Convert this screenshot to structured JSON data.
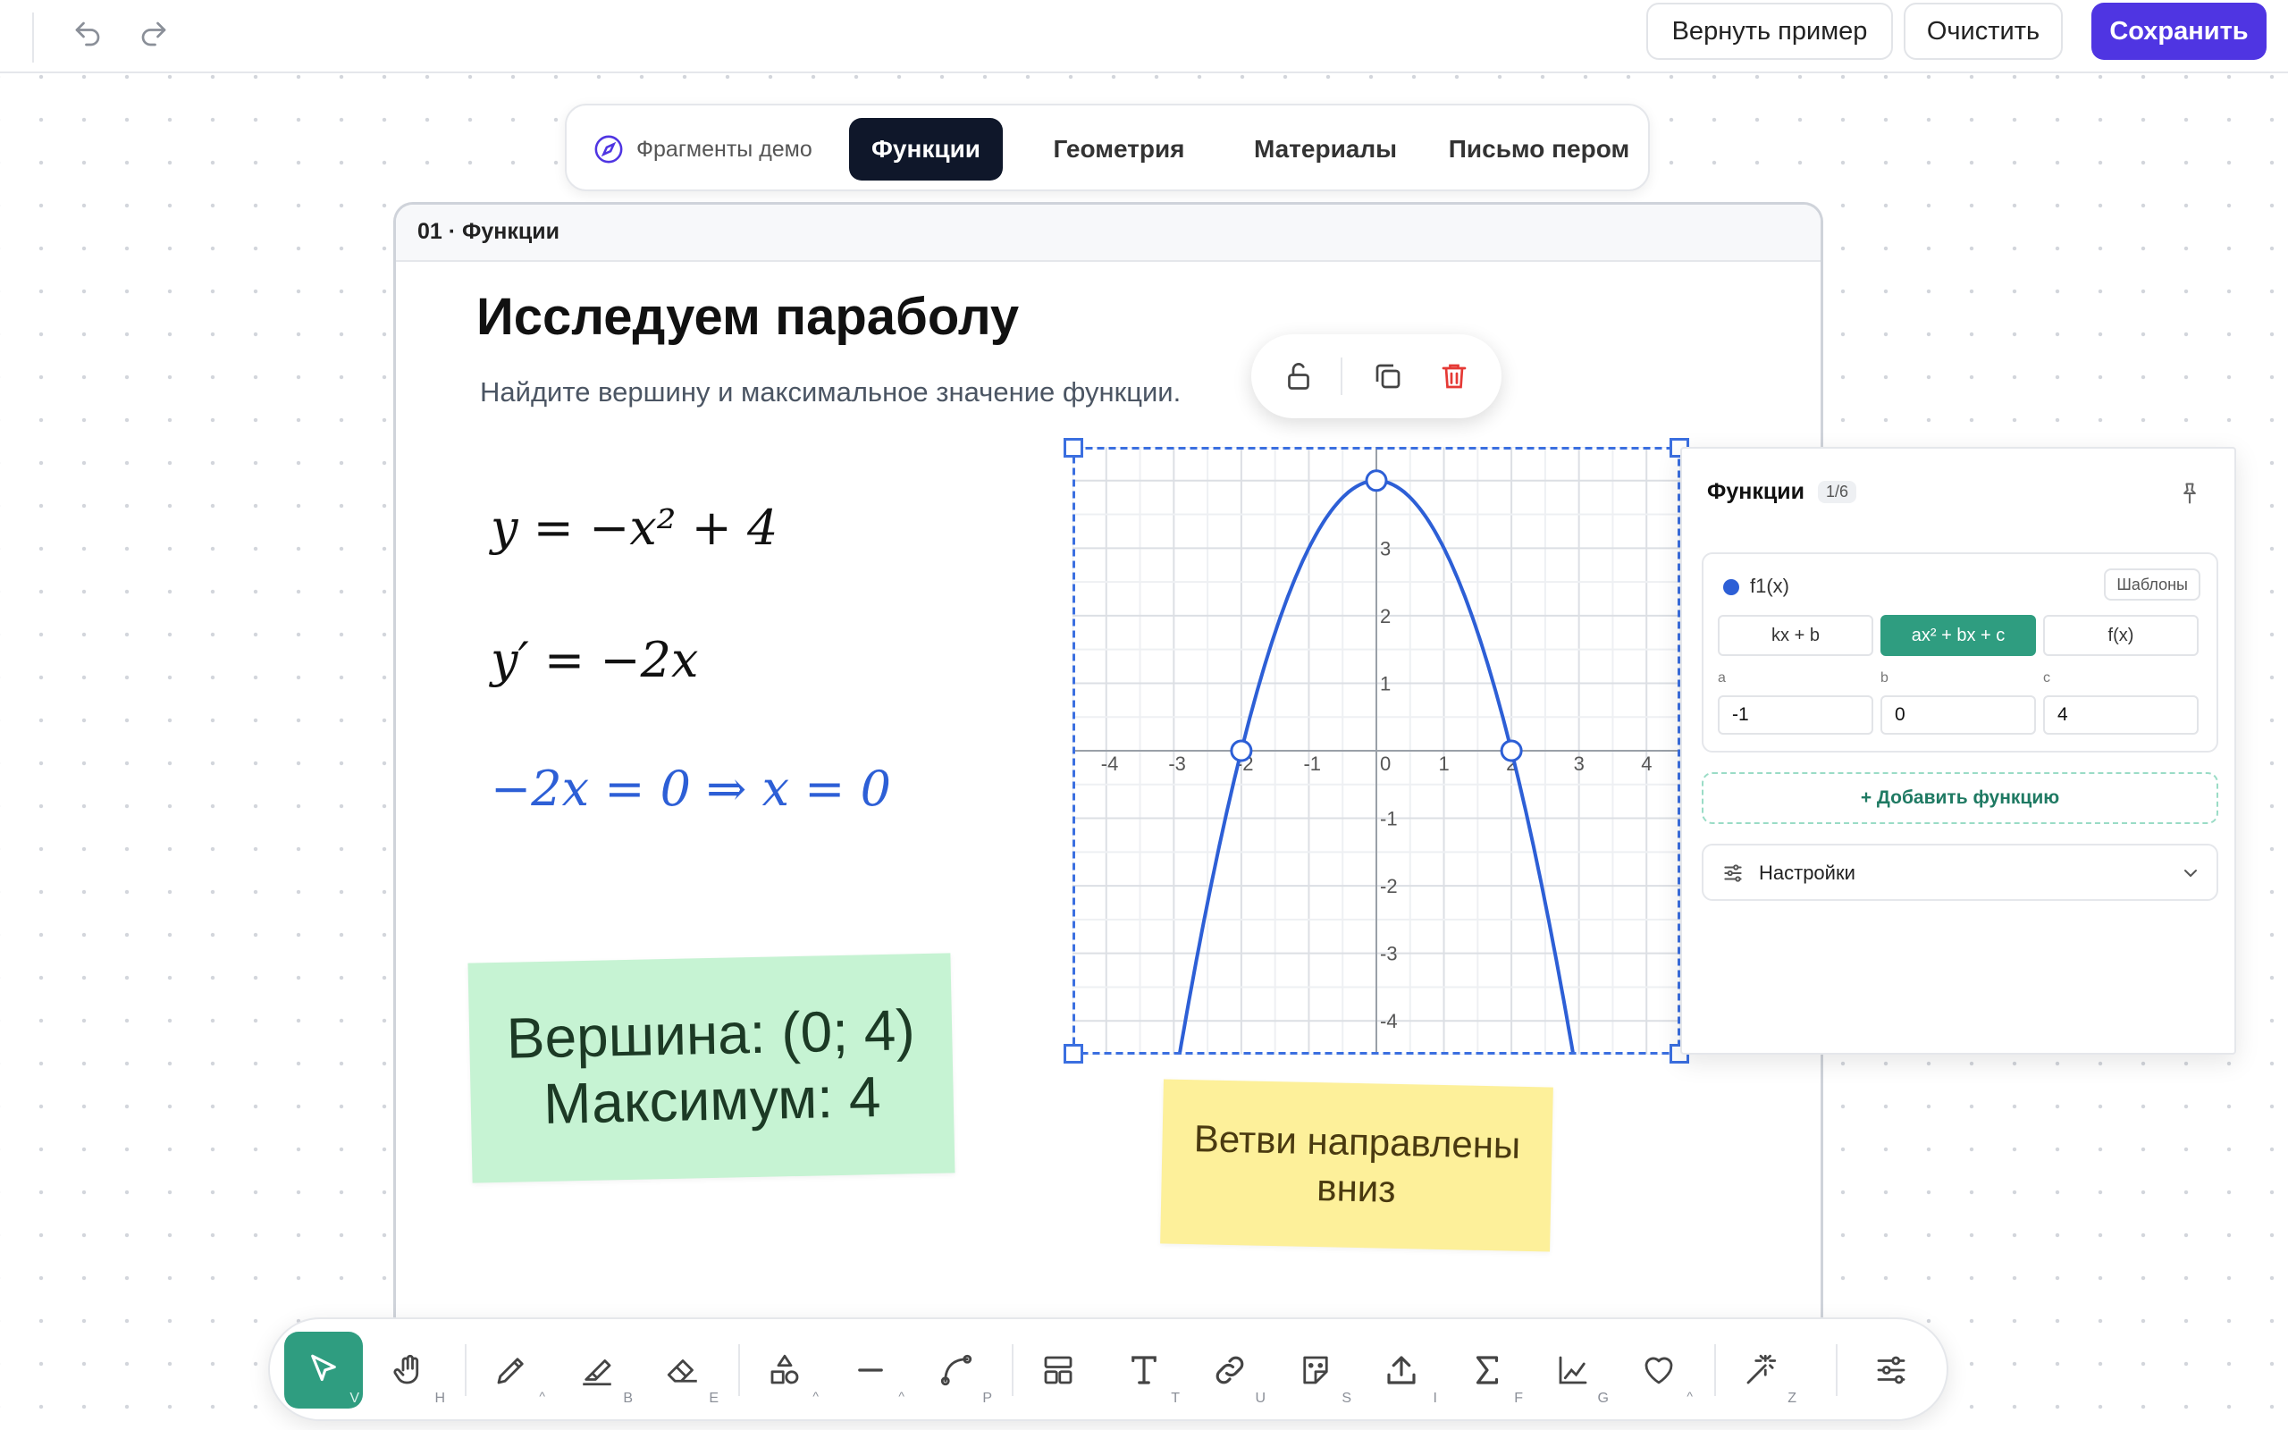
{
  "header": {
    "undo_icon": "undo-icon",
    "redo_icon": "redo-icon",
    "revert_label": "Вернуть пример",
    "clear_label": "Очистить",
    "save_label": "Сохранить",
    "accent_color": "#4f35e2"
  },
  "tabs": {
    "demo_label": "Фрагменты демо",
    "items": [
      "Функции",
      "Геометрия",
      "Материалы",
      "Письмо пером"
    ],
    "active": "Функции"
  },
  "slide": {
    "label": "01 · Функции",
    "title": "Исследуем параболу",
    "subtitle": "Найдите вершину и максимальное значение функции.",
    "equations": {
      "eq1": "y = −x² + 4",
      "eq2": "y′ = −2x",
      "eq3": "−2x = 0 ⇒ x = 0"
    },
    "note_green": {
      "line1": "Вершина: (0; 4)",
      "line2": "Максимум: 4",
      "color": "#c6f3d3"
    },
    "note_yellow": {
      "line1": "Ветви направлены",
      "line2": "вниз",
      "color": "#fdf09a"
    }
  },
  "context_toolbar": {
    "icons": [
      "unlock-icon",
      "duplicate-icon",
      "trash-icon"
    ]
  },
  "graph": {
    "function": "y = -x^2 + 4",
    "x_range": [
      -4.5,
      4.5
    ],
    "y_range": [
      -4.5,
      4.5
    ],
    "x_ticks": [
      "-4",
      "-3",
      "-2",
      "-1",
      "0",
      "1",
      "2",
      "3",
      "4"
    ],
    "y_ticks": [
      "3",
      "2",
      "1",
      "-1",
      "-2",
      "-3",
      "-4"
    ],
    "key_points": [
      [
        0,
        4
      ],
      [
        -2,
        0
      ],
      [
        2,
        0
      ]
    ],
    "curve_color": "#2d5fd6",
    "selection_color": "#3b6fe0"
  },
  "panel": {
    "title": "Функции",
    "count": "1/6",
    "function_name": "f1(x)",
    "templates_label": "Шаблоны",
    "types": [
      "kx + b",
      "ax² + bx + c",
      "f(x)"
    ],
    "active_type": "ax² + bx + c",
    "params": {
      "a_label": "a",
      "a_value": "-1",
      "b_label": "b",
      "b_value": "0",
      "c_label": "c",
      "c_value": "4"
    },
    "add_label": "+ Добавить функцию",
    "settings_label": "Настройки",
    "accent_color": "#2f9d80"
  },
  "toolbar": {
    "tools": [
      {
        "name": "select",
        "key": "V"
      },
      {
        "name": "hand",
        "key": "H"
      },
      {
        "name": "pen",
        "key": ""
      },
      {
        "name": "highlighter",
        "key": "B"
      },
      {
        "name": "eraser",
        "key": "E"
      },
      {
        "name": "shapes",
        "key": ""
      },
      {
        "name": "line",
        "key": ""
      },
      {
        "name": "curve",
        "key": "P"
      },
      {
        "name": "layout",
        "key": ""
      },
      {
        "name": "text",
        "key": "T"
      },
      {
        "name": "link",
        "key": "U"
      },
      {
        "name": "sticker",
        "key": "S"
      },
      {
        "name": "upload",
        "key": "I"
      },
      {
        "name": "formula",
        "key": "F"
      },
      {
        "name": "graph",
        "key": "G"
      },
      {
        "name": "heart",
        "key": ""
      },
      {
        "name": "magic",
        "key": "Z"
      },
      {
        "name": "settings",
        "key": ""
      }
    ],
    "active": "select"
  }
}
